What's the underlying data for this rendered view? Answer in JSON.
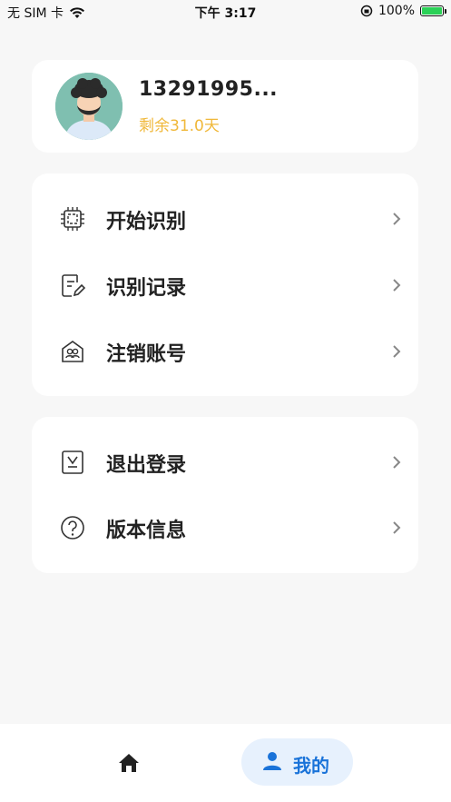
{
  "status_bar": {
    "carrier": "无 SIM 卡",
    "time": "下午 3:17",
    "battery_percent": "100%",
    "battery_level": 1.0
  },
  "profile": {
    "phone": "13291995...",
    "remaining": "剩余31.0天"
  },
  "menu_primary": [
    {
      "label": "开始识别",
      "icon": "chip-icon"
    },
    {
      "label": "识别记录",
      "icon": "edit-record-icon"
    },
    {
      "label": "注销账号",
      "icon": "account-icon"
    }
  ],
  "menu_secondary": [
    {
      "label": "退出登录",
      "icon": "logout-icon"
    },
    {
      "label": "版本信息",
      "icon": "question-icon"
    }
  ],
  "tabbar": {
    "home_icon": "home-icon",
    "me_label": "我的",
    "me_icon": "person-icon"
  },
  "colors": {
    "accent": "#1a73d9",
    "remaining": "#f0b83a",
    "battery": "#2bd157"
  }
}
